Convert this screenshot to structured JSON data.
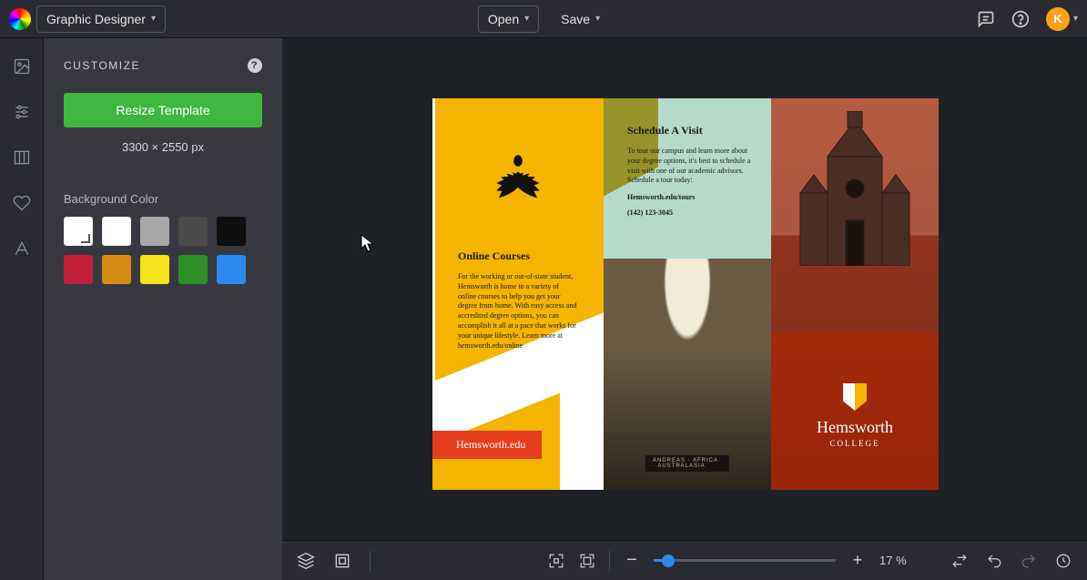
{
  "topbar": {
    "app_name": "Graphic Designer",
    "open_label": "Open",
    "save_label": "Save",
    "avatar_letter": "K"
  },
  "panel": {
    "title": "CUSTOMIZE",
    "resize_label": "Resize Template",
    "dimensions": "3300 × 2550 px",
    "bg_label": "Background Color",
    "swatches": [
      {
        "hex": "#ffffff",
        "selected": true
      },
      {
        "hex": "#ffffff"
      },
      {
        "hex": "#a7a7a7"
      },
      {
        "hex": "#4b4b4b"
      },
      {
        "hex": "#0f0f0f"
      },
      {
        "hex": "#c41f3b"
      },
      {
        "hex": "#d48b14"
      },
      {
        "hex": "#f4e21b"
      },
      {
        "hex": "#2f8f26"
      },
      {
        "hex": "#2b8aee"
      }
    ]
  },
  "brochure": {
    "panel1": {
      "heading": "Online Courses",
      "body": "For the working or out-of-state student, Hemsworth is home to a variety of online courses to help you get your degree from home. With easy access and accredited degree options, you can accomplish it all at a pace that works for your unique lifestyle. Learn more at hemsworth.edu/online",
      "url": "Hemsworth.edu"
    },
    "panel2": {
      "heading": "Schedule A Visit",
      "body": "To tour our campus and learn more about your degree options, it's best to schedule a visit with one of our academic advisors. Schedule a tour today:",
      "link": "Hemsworth.edu/tours",
      "phone": "(142) 123-3045",
      "plaque": "ANDREAS · AFRICA · AUSTRALASIA"
    },
    "panel3": {
      "name": "Hemsworth",
      "sub": "COLLEGE"
    }
  },
  "bottombar": {
    "zoom_pct": "17 %"
  }
}
